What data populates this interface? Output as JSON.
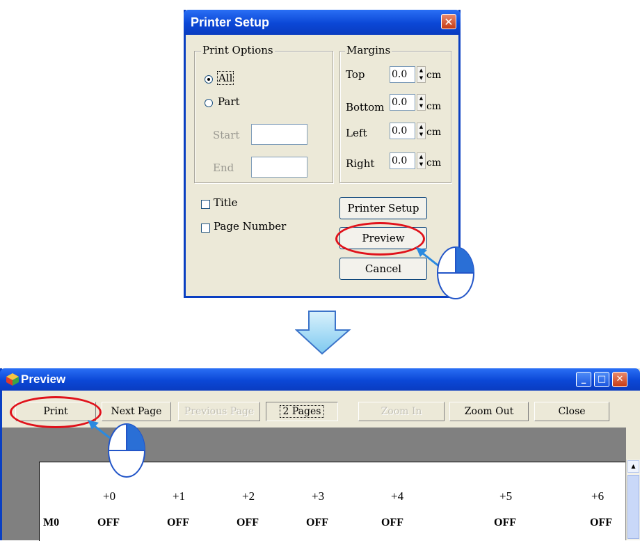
{
  "dialog": {
    "title": "Printer Setup",
    "print_options": {
      "label": "Print Options",
      "all_label": "All",
      "part_label": "Part",
      "selected": "All",
      "start_label": "Start",
      "end_label": "End",
      "start_value": "",
      "end_value": ""
    },
    "margins": {
      "label": "Margins",
      "unit": "cm",
      "top_label": "Top",
      "top_value": "0.0",
      "bottom_label": "Bottom",
      "bottom_value": "0.0",
      "left_label": "Left",
      "left_value": "0.0",
      "right_label": "Right",
      "right_value": "0.0"
    },
    "title_checkbox": "Title",
    "page_number_checkbox": "Page Number",
    "buttons": {
      "printer_setup": "Printer Setup",
      "preview": "Preview",
      "cancel": "Cancel"
    }
  },
  "preview": {
    "title": "Preview",
    "toolbar": {
      "print": "Print",
      "next_page": "Next Page",
      "previous_page": "Previous Page",
      "two_pages": "2 Pages",
      "zoom_in": "Zoom In",
      "zoom_out": "Zoom Out",
      "close": "Close"
    },
    "table": {
      "columns": [
        "+0",
        "+1",
        "+2",
        "+3",
        "+4",
        "+5",
        "+6"
      ],
      "rows": [
        {
          "label": "M0",
          "values": [
            "OFF",
            "OFF",
            "OFF",
            "OFF",
            "OFF",
            "OFF",
            "OFF"
          ]
        }
      ]
    }
  },
  "colors": {
    "titlebar": "#0b47d6",
    "dialog_bg": "#ece9d8",
    "highlight": "#e0121b",
    "arrow": "#8ed1f5"
  }
}
